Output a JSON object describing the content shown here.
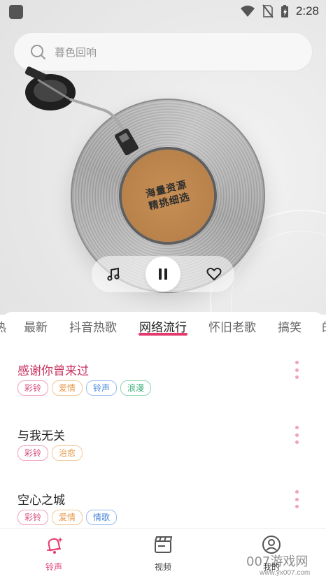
{
  "status": {
    "time": "2:28"
  },
  "search": {
    "placeholder": "暮色回响"
  },
  "hero": {
    "label_line1": "海量资源",
    "label_line2": "精挑细选"
  },
  "tabs": [
    {
      "label": "热"
    },
    {
      "label": "最新"
    },
    {
      "label": "抖音热歌"
    },
    {
      "label": "网络流行"
    },
    {
      "label": "怀旧老歌"
    },
    {
      "label": "搞笑"
    }
  ],
  "active_tab": "网络流行",
  "songs": [
    {
      "title": "感谢你曾来过",
      "tags": [
        "彩铃",
        "爱情",
        "铃声",
        "浪漫"
      ]
    },
    {
      "title": "与我无关",
      "tags": [
        "彩铃",
        "治愈"
      ]
    },
    {
      "title": "空心之城",
      "tags": [
        "彩铃",
        "爱情",
        "情歌"
      ]
    }
  ],
  "colors": {
    "accent": "#e53a6f",
    "tag_pink": "#d94a78",
    "tag_orange": "#e89a4a",
    "tag_blue": "#4a86d9",
    "tag_green": "#3bb07a"
  },
  "bottom_nav": [
    {
      "label": "铃声",
      "icon": "bell-icon"
    },
    {
      "label": "视频",
      "icon": "clapperboard-icon"
    },
    {
      "label": "我的",
      "icon": "profile-icon"
    }
  ],
  "watermark": {
    "text": "007游戏网",
    "url": "www.yx007.com"
  }
}
